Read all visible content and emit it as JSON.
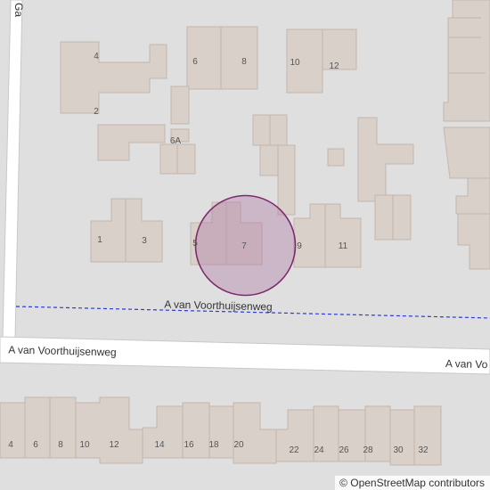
{
  "colors": {
    "landuse": "#e0dfdf",
    "building": "#d9d0c9",
    "building_stroke": "#c4b6ab",
    "road": "#ffffff",
    "road_casing": "#bfbfbf",
    "path": "#2b3bd6",
    "label": "#333333",
    "marker_fill": "#b07aa8",
    "marker_stroke": "#7e2a6f"
  },
  "street_labels": {
    "top_cut": "Ga",
    "dashed_path": "A van Voorthuijsenweg",
    "main_left": "A van Voorthuijsenweg",
    "main_right": "A van Vo"
  },
  "house_numbers": {
    "n4": "4",
    "n6": "6",
    "n8": "8",
    "n10": "10",
    "n12": "12",
    "n2": "2",
    "n6a": "6A",
    "n1": "1",
    "n3": "3",
    "n5": "5",
    "n7": "7",
    "n9": "9",
    "n11": "11",
    "s4": "4",
    "s6": "6",
    "s8": "8",
    "s10": "10",
    "s12": "12",
    "s14": "14",
    "s16": "16",
    "s18": "18",
    "s20": "20",
    "s22": "22",
    "s24": "24",
    "s26": "26",
    "s28": "28",
    "s30": "30",
    "s32": "32"
  },
  "attribution": {
    "symbol": "©",
    "text": "OpenStreetMap contributors"
  }
}
